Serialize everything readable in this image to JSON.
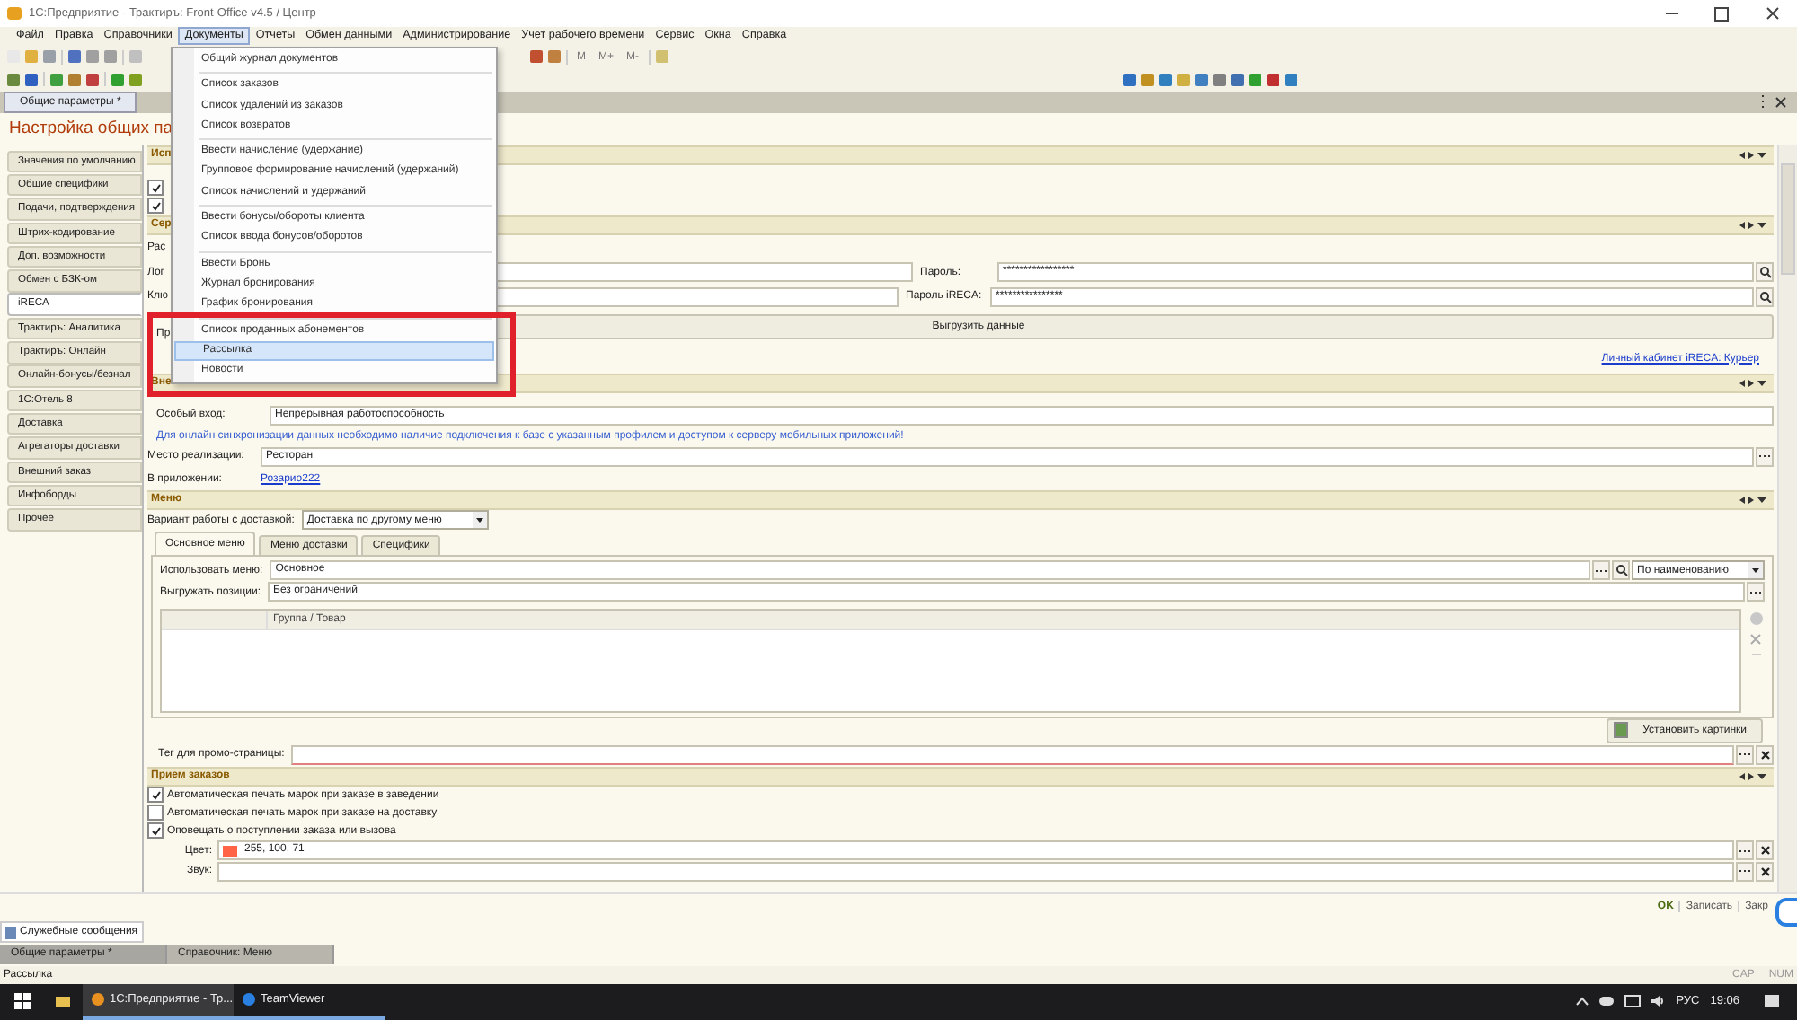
{
  "window": {
    "title": "1С:Предприятие - Трактиръ: Front-Office v4.5 / Центр"
  },
  "menu_bar": [
    {
      "label": "Файл",
      "selected": false
    },
    {
      "label": "Правка",
      "selected": false
    },
    {
      "label": "Справочники",
      "selected": false
    },
    {
      "label": "Документы",
      "selected": true
    },
    {
      "label": "Отчеты",
      "selected": false
    },
    {
      "label": "Обмен данными",
      "selected": false
    },
    {
      "label": "Администрирование",
      "selected": false
    },
    {
      "label": "Учет рабочего времени",
      "selected": false
    },
    {
      "label": "Сервис",
      "selected": false
    },
    {
      "label": "Окна",
      "selected": false
    },
    {
      "label": "Справка",
      "selected": false
    }
  ],
  "toolbar": {
    "memory_buttons": [
      "M",
      "M+",
      "M-"
    ]
  },
  "document_tab": {
    "label": "Общие параметры *"
  },
  "form": {
    "title": "Настройка общих па",
    "sidebar": [
      {
        "label": "Значения по умолчанию",
        "selected": false
      },
      {
        "label": "Общие специфики",
        "selected": false
      },
      {
        "label": "Подачи, подтверждения",
        "selected": false
      },
      {
        "label": "Штрих-кодирование",
        "selected": false
      },
      {
        "label": "Доп. возможности",
        "selected": false
      },
      {
        "label": "Обмен с БЗК-ом",
        "selected": false
      },
      {
        "label": "iRECA",
        "selected": true
      },
      {
        "label": "Трактиръ: Аналитика",
        "selected": false
      },
      {
        "label": "Трактиръ: Онлайн",
        "selected": false
      },
      {
        "label": "Онлайн-бонусы/безнал",
        "selected": false
      },
      {
        "label": "1С:Отель 8",
        "selected": false
      },
      {
        "label": "Доставка",
        "selected": false
      },
      {
        "label": "Агрегаторы доставки",
        "selected": false
      },
      {
        "label": "Внешний заказ",
        "selected": false
      },
      {
        "label": "Инфоборды",
        "selected": false
      },
      {
        "label": "Прочее",
        "selected": false
      }
    ],
    "ireca": {
      "section_1": "Исп",
      "checks": [
        {
          "checked": true
        },
        {
          "checked": true
        }
      ],
      "section_2": "Сер",
      "label_1": "Рас",
      "login_label": "Лог",
      "key_label": "Клю",
      "password_label": "Пароль:",
      "password_value": "*****************",
      "ireca_password_label": "Пароль iRECA:",
      "ireca_password_value": "****************",
      "label_2": "Пр",
      "export_button": "Выгрузить данные",
      "cabinet_link": "Личный кабинет iRECA: Курьер",
      "section_3": "Вне",
      "special_label": "Особый вход:",
      "special_value": "Непрерывная работоспособность",
      "info": "Для онлайн синхронизации данных необходимо наличие подключения к базе с указанным профилем и доступом к серверу мобильных приложений!",
      "place_label": "Место реализации:",
      "place_value": "Ресторан",
      "app_label": "В приложении:",
      "app_link": "Розарио222"
    },
    "menu": {
      "section": "Меню",
      "variant_label": "Вариант работы с доставкой:",
      "variant_value": "Доставка по другому меню",
      "tabs": [
        {
          "label": "Основное меню",
          "selected": true
        },
        {
          "label": "Меню доставки",
          "selected": false
        },
        {
          "label": "Специфики",
          "selected": false
        }
      ],
      "use_menu_label": "Использовать меню:",
      "use_menu_value": "Основное",
      "search_mode": "По наименованию",
      "export_label": "Выгружать позиции:",
      "export_value": "Без ограничений",
      "table": {
        "columns": [
          "Группа / Товар"
        ]
      },
      "pictures_button": "Установить картинки",
      "promo_label": "Тег для промо-страницы:"
    },
    "orders": {
      "section": "Прием заказов",
      "checks": [
        {
          "label": "Автоматическая печать марок при заказе в заведении",
          "checked": true
        },
        {
          "label": "Автоматическая печать марок при заказе на доставку",
          "checked": false
        },
        {
          "label": "Оповещать о поступлении заказа или вызова",
          "checked": true
        }
      ],
      "color_label": "Цвет:",
      "color_value": "255, 100, 71",
      "sound_label": "Звук:"
    },
    "commands": [
      "OK",
      "Записать",
      "Закр"
    ]
  },
  "dropdown": {
    "groups": [
      [
        {
          "label": "Общий журнал документов",
          "selected": false
        }
      ],
      [
        {
          "label": "Список заказов",
          "selected": false
        },
        {
          "label": "Список удалений из заказов",
          "selected": false
        },
        {
          "label": "Список возвратов",
          "selected": false
        }
      ],
      [
        {
          "label": "Ввести начисление (удержание)",
          "selected": false
        },
        {
          "label": "Групповое формирование начислений (удержаний)",
          "selected": false
        },
        {
          "label": "Список начислений и удержаний",
          "selected": false
        }
      ],
      [
        {
          "label": "Ввести бонусы/обороты клиента",
          "selected": false
        },
        {
          "label": "Список ввода бонусов/оборотов",
          "selected": false
        }
      ],
      [
        {
          "label": "Ввести Бронь",
          "selected": false
        },
        {
          "label": "Журнал бронирования",
          "selected": false
        },
        {
          "label": "График бронирования",
          "selected": false
        }
      ],
      [
        {
          "label": "Список проданных абонементов",
          "selected": false
        },
        {
          "label": "Рассылка",
          "selected": true
        },
        {
          "label": "Новости",
          "selected": false
        }
      ]
    ]
  },
  "service_messages": {
    "label": "Служебные сообщения"
  },
  "window_tabs": [
    {
      "label": "Общие параметры *",
      "selected": true
    },
    {
      "label": "Справочник: Меню",
      "selected": false
    }
  ],
  "status_bar": {
    "text": "Рассылка",
    "indicators": [
      "CAP",
      "NUM"
    ]
  },
  "taskbar": {
    "apps": [
      {
        "label": "1С:Предприятие - Тр...",
        "selected": true
      },
      {
        "label": "TeamViewer",
        "selected": false
      }
    ],
    "language": "РУС",
    "time": "19:06"
  }
}
